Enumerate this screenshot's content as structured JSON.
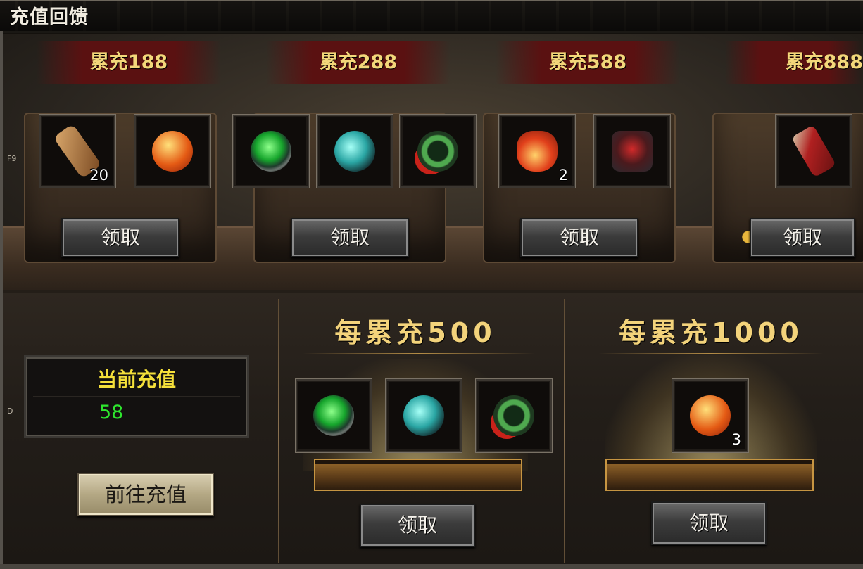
{
  "window": {
    "title": "充值回馈"
  },
  "side_labels": [
    "F9",
    "D"
  ],
  "tiers": [
    {
      "label": "累充188",
      "claim_label": "领取",
      "items": [
        {
          "icon": "scroll-icon",
          "cls": "it-scroll",
          "count": "20"
        },
        {
          "icon": "fire-gem-icon",
          "cls": "it-orange",
          "count": ""
        }
      ]
    },
    {
      "label": "累充288",
      "claim_label": "领取",
      "items": [
        {
          "icon": "green-orb-icon",
          "cls": "it-green",
          "count": ""
        },
        {
          "icon": "teal-crystal-icon",
          "cls": "it-teal",
          "count": ""
        },
        {
          "icon": "jade-amulet-icon",
          "cls": "it-jade",
          "count": ""
        }
      ]
    },
    {
      "label": "累充588",
      "claim_label": "领取",
      "items": [
        {
          "icon": "potion-icon",
          "cls": "it-potion",
          "count": "2"
        },
        {
          "icon": "armor-icon",
          "cls": "it-armor",
          "count": ""
        }
      ]
    },
    {
      "label": "累充888",
      "claim_label": "领取",
      "items": [
        {
          "icon": "red-scroll-icon",
          "cls": "it-redscroll",
          "count": ""
        }
      ]
    }
  ],
  "current": {
    "label": "当前充值",
    "value": "58"
  },
  "recharge_button": "前往充值",
  "repeat_rewards": [
    {
      "label": "每累充500",
      "claim_label": "领取",
      "items": [
        {
          "icon": "green-orb-icon",
          "cls": "it-green",
          "count": ""
        },
        {
          "icon": "teal-crystal-icon",
          "cls": "it-teal",
          "count": ""
        },
        {
          "icon": "jade-amulet-icon",
          "cls": "it-jade",
          "count": ""
        }
      ]
    },
    {
      "label": "每累充1000",
      "claim_label": "领取",
      "items": [
        {
          "icon": "fire-gem-icon",
          "cls": "it-orange",
          "count": "3"
        }
      ]
    }
  ]
}
